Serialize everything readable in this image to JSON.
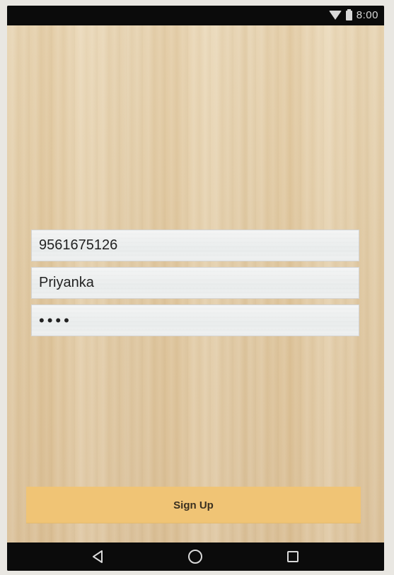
{
  "status_bar": {
    "time": "8:00",
    "icons": [
      "wifi-icon",
      "battery-icon"
    ]
  },
  "form": {
    "phone_value": "9561675126",
    "name_value": "Priyanka",
    "password_value": "••••"
  },
  "actions": {
    "signup_label": "Sign Up"
  },
  "nav_bar": {
    "icons": [
      "back-icon",
      "home-icon",
      "recents-icon"
    ]
  },
  "colors": {
    "accent": "#f0c475",
    "status_bar": "#0b0b0b"
  }
}
